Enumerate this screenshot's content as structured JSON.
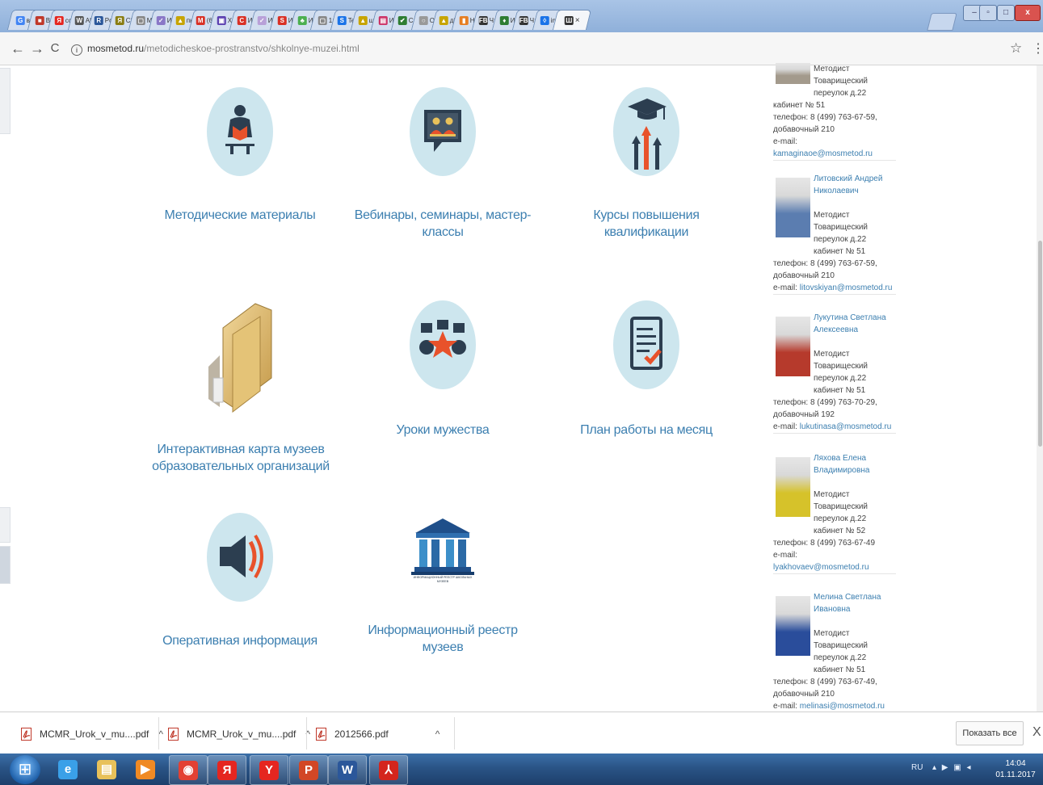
{
  "browser": {
    "tabs": [
      {
        "label": "G",
        "text": "в",
        "color": "#4285f4"
      },
      {
        "label": "■",
        "text": "В",
        "color": "#c0392b"
      },
      {
        "label": "Я",
        "text": "сс",
        "color": "#e52620"
      },
      {
        "label": "W",
        "text": "Al",
        "color": "#555555"
      },
      {
        "label": "R",
        "text": "Pc",
        "color": "#2b579a"
      },
      {
        "label": "Я",
        "text": "Сі",
        "color": "#8a7d12"
      },
      {
        "label": "▢",
        "text": "M",
        "color": "#888888"
      },
      {
        "label": "✓",
        "text": "И",
        "color": "#8a77c7"
      },
      {
        "label": "▲",
        "text": "пк",
        "color": "#c7a400"
      },
      {
        "label": "M",
        "text": "(6",
        "color": "#d93025"
      },
      {
        "label": "▣",
        "text": "X",
        "color": "#5b3fb0"
      },
      {
        "label": "C",
        "text": "И",
        "color": "#d93025"
      },
      {
        "label": "✓",
        "text": "И",
        "color": "#b8a0d8"
      },
      {
        "label": "S",
        "text": "И",
        "color": "#d93025"
      },
      {
        "label": "♣",
        "text": "И",
        "color": "#4caf50"
      },
      {
        "label": "▢",
        "text": "1;",
        "color": "#888888"
      },
      {
        "label": "S",
        "text": "Te",
        "color": "#1a73e8"
      },
      {
        "label": "▲",
        "text": "ш",
        "color": "#c7a400"
      },
      {
        "label": "▤",
        "text": "И",
        "color": "#cc3366"
      },
      {
        "label": "✔",
        "text": "C:",
        "color": "#2e7d32"
      },
      {
        "label": "○",
        "text": "О",
        "color": "#999999"
      },
      {
        "label": "▲",
        "text": "ді",
        "color": "#c7a400"
      },
      {
        "label": "▮",
        "text": "Н",
        "color": "#e67e22"
      },
      {
        "label": "FB",
        "text": "Ч:",
        "color": "#333333"
      },
      {
        "label": "♦",
        "text": "И",
        "color": "#2e7d32"
      },
      {
        "label": "FB",
        "text": "Ч:",
        "color": "#333333"
      },
      {
        "label": "◊",
        "text": "in",
        "color": "#1a73e8"
      }
    ],
    "active_tab": {
      "label": "Ш",
      "color": "#333333"
    },
    "close_glyph": "×",
    "window_buttons": {
      "minimize": "–",
      "restore": "▫",
      "maximize": "□",
      "close": "x"
    },
    "nav": {
      "back": "←",
      "forward": "→",
      "reload": "C"
    },
    "url_host": "mosmetod.ru",
    "url_path": "/metodicheskoe-prostranstvo/shkolnye-muzei.html",
    "info_glyph": "i",
    "star_glyph": "☆",
    "menu_glyph": "⋮"
  },
  "page": {
    "items": [
      {
        "label": "Методические материалы",
        "icon": "reading-person-icon"
      },
      {
        "label": "Вебинары, семинары, мастер-классы",
        "icon": "webinar-chat-icon"
      },
      {
        "label": "Курсы повышения квалификации",
        "icon": "graduation-growth-icon"
      },
      {
        "label": "Интерактивная карта музеев образовательных организаций",
        "icon": "folder-icon"
      },
      {
        "label": "Уроки мужества",
        "icon": "medals-icon"
      },
      {
        "label": "План работы на месяц",
        "icon": "checklist-icon"
      },
      {
        "label": "Оперативная информация",
        "icon": "speaker-icon"
      },
      {
        "label": "Информационный реестр музеев",
        "icon": "museum-registry-icon"
      }
    ],
    "registry_logo_text": "ИНФОРМАЦИОННЫЙ РЕЕСТР ШКОЛЬНЫХ МУЗЕЕВ"
  },
  "staff": [
    {
      "name": "",
      "lines": [
        "Методист",
        "Товарищеский",
        "переулок д.22"
      ],
      "contacts": [
        "кабинет № 51",
        "телефон: 8 (499) 763-67-59,",
        "добавочный 210",
        "e-mail:"
      ],
      "email": "kamaginaoe@mosmetod.ru",
      "photo": "#a39a8c"
    },
    {
      "name": "Литовский Андрей Николаевич",
      "lines": [
        "Методист",
        "Товарищеский",
        "переулок д.22",
        "кабинет № 51"
      ],
      "contacts": [
        "телефон: 8 (499) 763-67-59,",
        "добавочный 210"
      ],
      "email_prefix": "e-mail:",
      "email": "litovskiyan@mosmetod.ru",
      "photo": "#5b7db0"
    },
    {
      "name": "Лукутина Светлана Алексеевна",
      "lines": [
        "Методист",
        "Товарищеский",
        "переулок д.22",
        "кабинет № 51"
      ],
      "contacts": [
        "телефон: 8 (499) 763-70-29,",
        "добавочный 192"
      ],
      "email_prefix": "e-mail:",
      "email": "lukutinasa@mosmetod.ru",
      "photo": "#b63a2c"
    },
    {
      "name": "Ляхова Елена Владимировна",
      "lines": [
        "Методист",
        "Товарищеский",
        "переулок д.22",
        "кабинет № 52"
      ],
      "contacts": [
        "телефон: 8 (499) 763-67-49",
        "e-mail:"
      ],
      "email": "lyakhovaev@mosmetod.ru",
      "photo": "#d6c22a"
    },
    {
      "name": "Мелина Светлана Ивановна",
      "lines": [
        "Методист",
        "Товарищеский",
        "переулок д.22",
        "кабинет № 51"
      ],
      "contacts": [
        "телефон: 8 (499) 763-67-49,",
        "добавочный 210"
      ],
      "email_prefix": "e-mail:",
      "email": "melinasi@mosmetod.ru",
      "photo": "#2a4d9b"
    }
  ],
  "downloads": {
    "items": [
      "MCMR_Urok_v_mu....pdf",
      "MCMR_Urok_v_mu....pdf",
      "2012566.pdf"
    ],
    "chevron": "^",
    "show_all": "Показать все",
    "close": "X"
  },
  "taskbar": {
    "pinned": [
      {
        "name": "ie-icon",
        "glyph": "e",
        "color": "#3aa0e8"
      },
      {
        "name": "explorer-icon",
        "glyph": "▤",
        "color": "#e8c15a"
      },
      {
        "name": "media-player-icon",
        "glyph": "▶",
        "color": "#f08a24"
      },
      {
        "name": "chrome-icon",
        "glyph": "◉",
        "color": "#e34133"
      },
      {
        "name": "yandex-icon",
        "glyph": "Я",
        "color": "#e52620"
      },
      {
        "name": "yandex-browser-icon",
        "glyph": "Y",
        "color": "#e52620"
      },
      {
        "name": "powerpoint-icon",
        "glyph": "P",
        "color": "#d24726"
      },
      {
        "name": "word-icon",
        "glyph": "W",
        "color": "#2b579a"
      },
      {
        "name": "acrobat-icon",
        "glyph": "⅄",
        "color": "#d4251d"
      }
    ],
    "start_glyph": "⊞",
    "lang": "RU",
    "tray_icons": "▴ ▶ ▣ ◂",
    "time": "14:04",
    "date": "01.11.2017"
  },
  "colors": {
    "accent": "#3c7fb0",
    "circle": "#cde6ee",
    "icon_dark": "#2c3e50",
    "icon_orange": "#e8522b"
  }
}
